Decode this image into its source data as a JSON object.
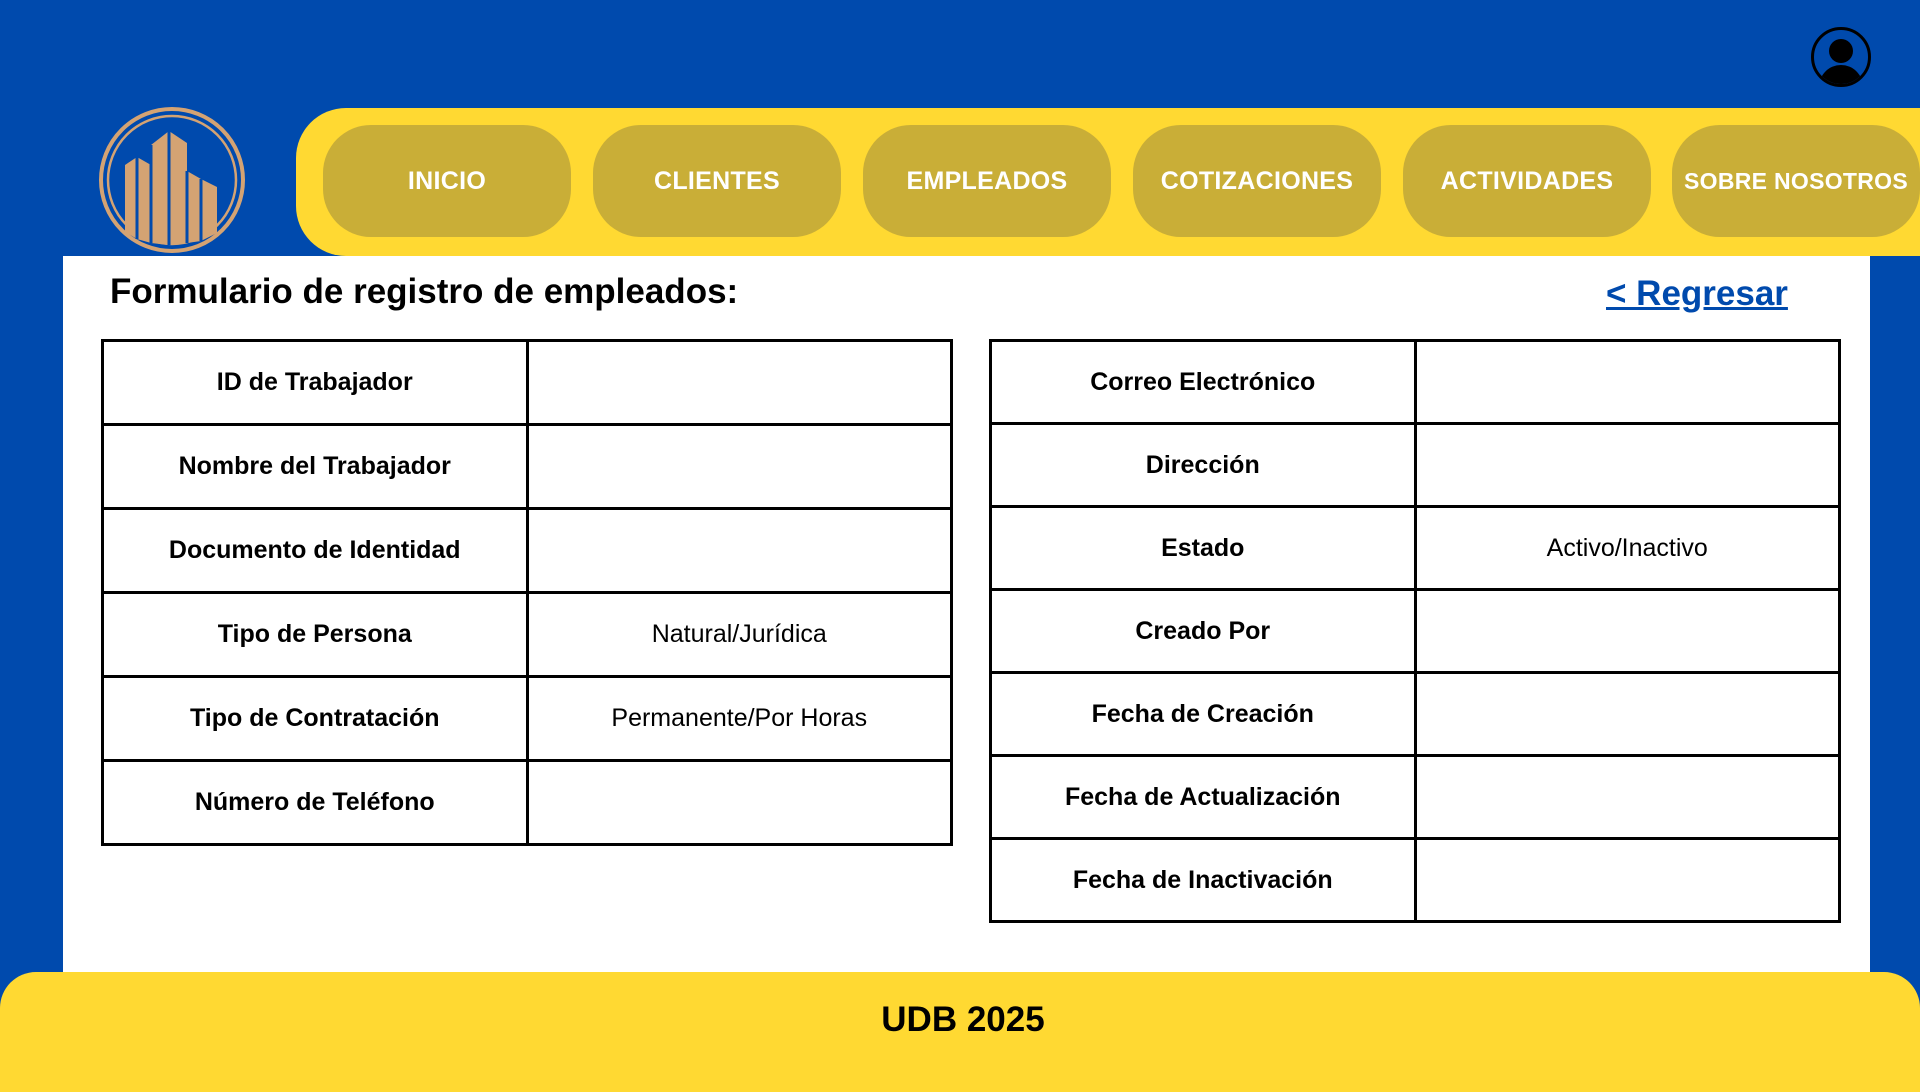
{
  "header": {
    "avatar_icon": "user-avatar-icon",
    "logo_icon": "building-logo-icon"
  },
  "nav": {
    "items": [
      {
        "label": "INICIO"
      },
      {
        "label": "CLIENTES"
      },
      {
        "label": "EMPLEADOS"
      },
      {
        "label": "COTIZACIONES"
      },
      {
        "label": "ACTIVIDADES"
      },
      {
        "label": "SOBRE NOSOTROS"
      }
    ]
  },
  "page": {
    "title": "Formulario de registro de empleados:",
    "back_link": "< Regresar"
  },
  "form_left": [
    {
      "label": "ID de Trabajador",
      "value": ""
    },
    {
      "label": "Nombre del Trabajador",
      "value": ""
    },
    {
      "label": "Documento de Identidad",
      "value": ""
    },
    {
      "label": "Tipo de Persona",
      "value": "Natural/Jurídica"
    },
    {
      "label": "Tipo de Contratación",
      "value": "Permanente/Por Horas"
    },
    {
      "label": "Número de Teléfono",
      "value": ""
    }
  ],
  "form_right": [
    {
      "label": "Correo Electrónico",
      "value": ""
    },
    {
      "label": "Dirección",
      "value": ""
    },
    {
      "label": "Estado",
      "value": "Activo/Inactivo"
    },
    {
      "label": "Creado Por",
      "value": ""
    },
    {
      "label": "Fecha de Creación",
      "value": ""
    },
    {
      "label": "Fecha de Actualización",
      "value": ""
    },
    {
      "label": "Fecha de Inactivación",
      "value": ""
    }
  ],
  "footer": {
    "text": "UDB 2025"
  },
  "colors": {
    "background": "#004aad",
    "accent_yellow": "#ffd932",
    "nav_button": "#c9ae37",
    "logo_gold": "#d4a373"
  }
}
